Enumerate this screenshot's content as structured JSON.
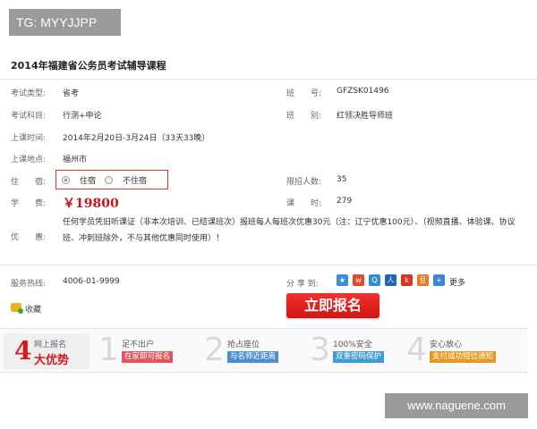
{
  "watermarks": {
    "top": "TG: MYYJJPP",
    "bottom": "www.naguene.com"
  },
  "course": {
    "title": "2014年福建省公务员考试辅导课程",
    "fields_left": [
      {
        "label": "考试类型:",
        "value": "省考"
      },
      {
        "label": "考试科目:",
        "value": "行测+申论"
      },
      {
        "label": "上课时间:",
        "value": "2014年2月20日-3月24日（33天33晚）"
      },
      {
        "label": "上课地点:",
        "value": "福州市"
      }
    ],
    "fields_right": [
      {
        "label": "班　　号:",
        "value": "GFZSK01496"
      },
      {
        "label": "班　　别:",
        "value": "红领决胜导师班"
      }
    ],
    "lodging": {
      "label": "住　　宿:",
      "options": [
        "住宿",
        "不住宿"
      ],
      "selected": "住宿"
    },
    "quota": {
      "label": "限招人数:",
      "value": "35"
    },
    "fee": {
      "label": "学　　费:",
      "value": "￥19800"
    },
    "hours": {
      "label": "课　　时:",
      "value": "279"
    },
    "promo": {
      "label": "优　　惠:",
      "text": "任何学员凭旧听课证（非本次培训、已结课班次）报班每人每班次优惠30元（注：辽宁优惠100元）、（视频直播、体验课、协议班、冲刺班除外，不与其他优惠同时使用）！"
    }
  },
  "contact": {
    "hotline_label": "服务热线:",
    "hotline": "4006-01-9999"
  },
  "share": {
    "label": "分 享 到:",
    "icons": [
      {
        "name": "qzone-icon",
        "glyph": "★",
        "color": "#3b8fd9"
      },
      {
        "name": "weibo-icon",
        "glyph": "w",
        "color": "#e24b2c"
      },
      {
        "name": "qq-icon",
        "glyph": "Q",
        "color": "#2f8fd6"
      },
      {
        "name": "renren-icon",
        "glyph": "人",
        "color": "#2066b8"
      },
      {
        "name": "kaixin-icon",
        "glyph": "k",
        "color": "#d9341f"
      },
      {
        "name": "douban-icon",
        "glyph": "豆",
        "color": "#e8792a"
      },
      {
        "name": "plus-icon",
        "glyph": "+",
        "color": "#3f84d6"
      }
    ],
    "more": "更多"
  },
  "favorite": {
    "label": "收藏"
  },
  "signup_button": "立即报名",
  "advantages": {
    "head_num": "4",
    "head_line1": "网上报名",
    "head_line2": "大优势",
    "items": [
      {
        "num": "1",
        "title": "足不出户",
        "tag": "在家即可报名",
        "color": "#e0565a"
      },
      {
        "num": "2",
        "title": "抢占座位",
        "tag": "与名师近距离",
        "color": "#4a8fd2"
      },
      {
        "num": "3",
        "title": "100%安全",
        "tag": "双重密码保护",
        "color": "#3f9ad6"
      },
      {
        "num": "4",
        "title": "安心放心",
        "tag": "支付成功短信通知",
        "color": "#e69a22"
      }
    ]
  }
}
